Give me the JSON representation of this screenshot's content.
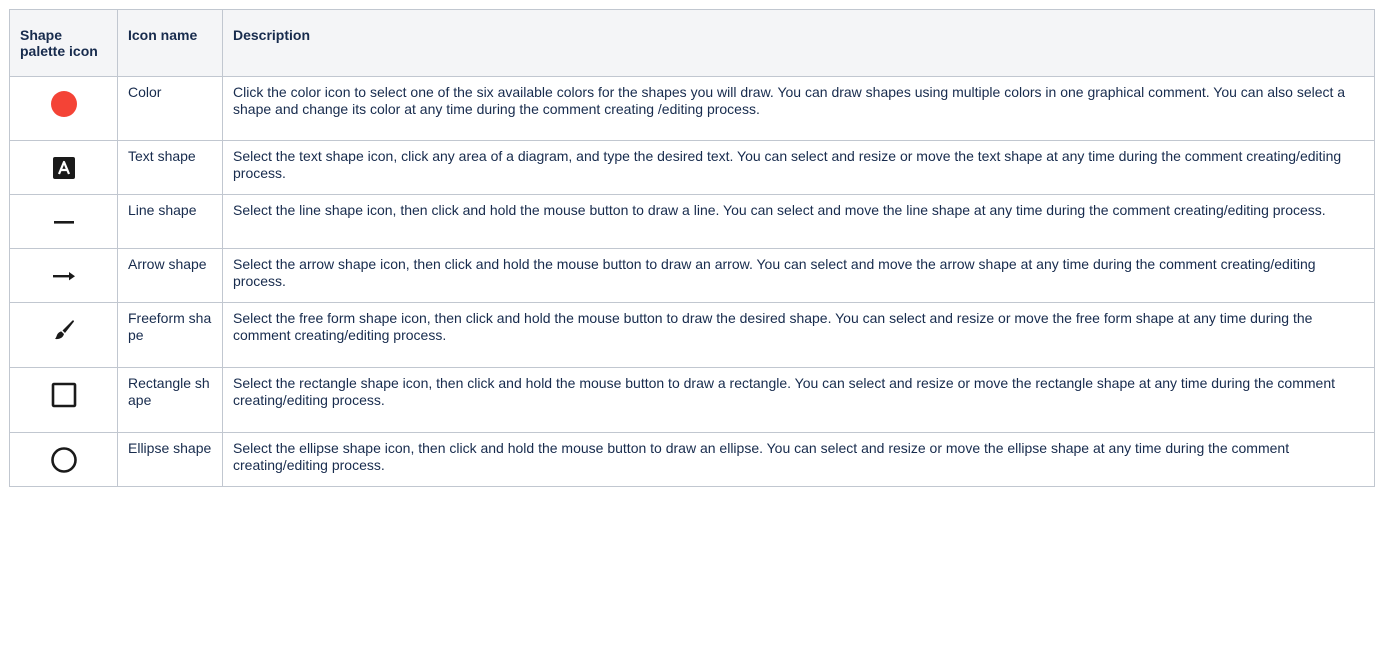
{
  "table": {
    "headers": {
      "icon": "Shape palette icon",
      "name": "Icon name",
      "description": "Description"
    },
    "rows": [
      {
        "icon": "red-circle-icon",
        "name": "Color",
        "description": "Click the color icon to select one of the six available colors for the shapes you will draw. You can draw shapes using multiple colors in one graphical comment. You can also select a shape and change its color at any time during the comment creating /editing process."
      },
      {
        "icon": "text-a-icon",
        "name": "Text shape",
        "description": "Select the text shape icon, click any area of a diagram, and type the desired text. You can select and resize or move the text shape at any time during the comment creating/editing process."
      },
      {
        "icon": "line-icon",
        "name": "Line shape",
        "description": "Select the line shape icon, then click and hold the mouse button to draw a line. You can select and move the line shape at any time during the comment creating/editing process."
      },
      {
        "icon": "arrow-right-icon",
        "name": "Arrow shape",
        "description": "Select the arrow shape icon, then click and hold the mouse button to draw an arrow. You can select and move the arrow shape at any time during the comment creating/editing process."
      },
      {
        "icon": "brush-icon",
        "name": "Freeform shape",
        "description": "Select the free form shape icon, then click and hold the mouse button to draw the desired shape. You can select and resize or move the free form shape at any time during the comment creating/editing process."
      },
      {
        "icon": "square-outline-icon",
        "name": "Rectangle shape",
        "description": "Select the rectangle shape icon, then click and hold the mouse button to draw a rectangle. You can select and resize or move the rectangle shape at any time during the comment creating/editing process."
      },
      {
        "icon": "circle-outline-icon",
        "name": "Ellipse shape",
        "description": "Select the ellipse shape icon, then click and hold the mouse button to draw an ellipse. You can select and resize or move the ellipse shape at any time during the comment creating/editing process."
      }
    ]
  },
  "colors": {
    "color_icon": "#f44336",
    "icon_dark": "#1a1a1a"
  }
}
